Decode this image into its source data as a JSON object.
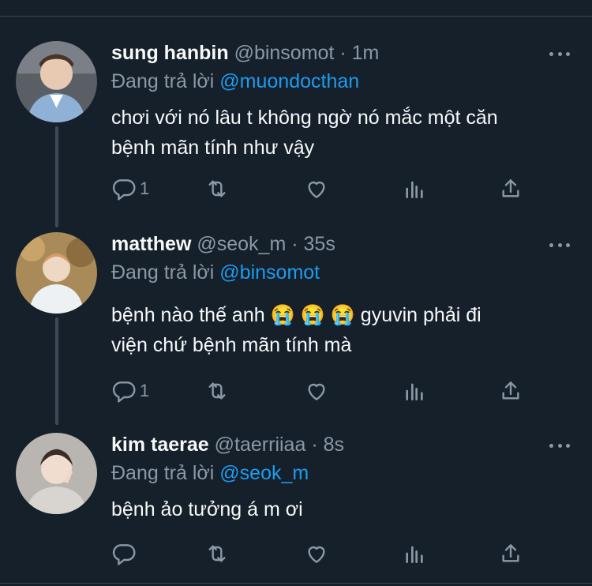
{
  "tweets": [
    {
      "name": "sung hanbin",
      "handle": "@binsomot",
      "separator": "·",
      "time": "1m",
      "reply_prefix": "Đang trả lời",
      "reply_to": "@muondocthan",
      "lines": [
        "chơi với nó lâu t không ngờ nó mắc một căn",
        "bệnh mãn tính như vậy"
      ],
      "reply_count": "1"
    },
    {
      "name": "matthew",
      "handle": "@seok_m",
      "separator": "·",
      "time": "35s",
      "reply_prefix": "Đang trả lời",
      "reply_to": "@binsomot",
      "lines": [
        "bệnh nào thế anh 😭 😭 😭  gyuvin phải đi",
        "viện chứ bệnh mãn tính mà"
      ],
      "reply_count": "1"
    },
    {
      "name": "kim taerae",
      "handle": "@taerriiaa",
      "separator": "·",
      "time": "8s",
      "reply_prefix": "Đang trả lời",
      "reply_to": "@seok_m",
      "lines": [
        "bệnh ảo tưởng á m ơi"
      ],
      "reply_count": ""
    }
  ],
  "icons": {
    "reply": "reply-icon",
    "retweet": "retweet-icon",
    "like": "heart-icon",
    "views": "analytics-icon",
    "share": "share-icon",
    "more": "more-icon"
  },
  "colors": {
    "background": "#15202b",
    "text": "#f7f9f9",
    "muted": "#8b98a5",
    "accent": "#1d9bf0",
    "thread_line": "#3d4a55"
  }
}
